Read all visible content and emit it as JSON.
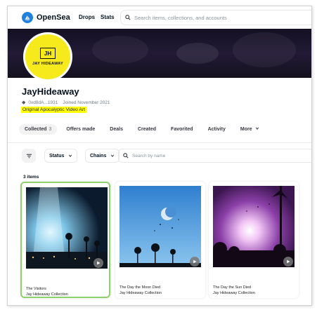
{
  "nav": {
    "brand": "OpenSea",
    "links": [
      "Drops",
      "Stats"
    ],
    "search_placeholder": "Search items, collections, and accounts"
  },
  "profile": {
    "avatar_initials": "JH",
    "avatar_name": "JAY HIDEAWAY",
    "name": "JayHideaway",
    "address": "0xd8dA...1931",
    "joined": "Joined November 2021",
    "bio": "Original Apocalyptic Video Art"
  },
  "tabs": [
    {
      "label": "Collected",
      "count": "3",
      "active": true
    },
    {
      "label": "Offers made"
    },
    {
      "label": "Deals"
    },
    {
      "label": "Created"
    },
    {
      "label": "Favorited"
    },
    {
      "label": "Activity"
    },
    {
      "label": "More"
    }
  ],
  "filters": {
    "status_label": "Status",
    "chains_label": "Chains",
    "search_placeholder": "Search by name"
  },
  "items_count": "3 items",
  "items": [
    {
      "title": "The Visitors",
      "collection": "Jay Hideaway Collection",
      "selected": true
    },
    {
      "title": "The Day the Moon Died",
      "collection": "Jay Hideaway Collection"
    },
    {
      "title": "The Day the Sun Died",
      "collection": "Jay Hideaway Collection"
    }
  ],
  "colors": {
    "brand_blue": "#2081e2",
    "avatar_yellow": "#f6ea1c",
    "highlight": "#fffe00",
    "selected_border": "#8fd16a"
  }
}
